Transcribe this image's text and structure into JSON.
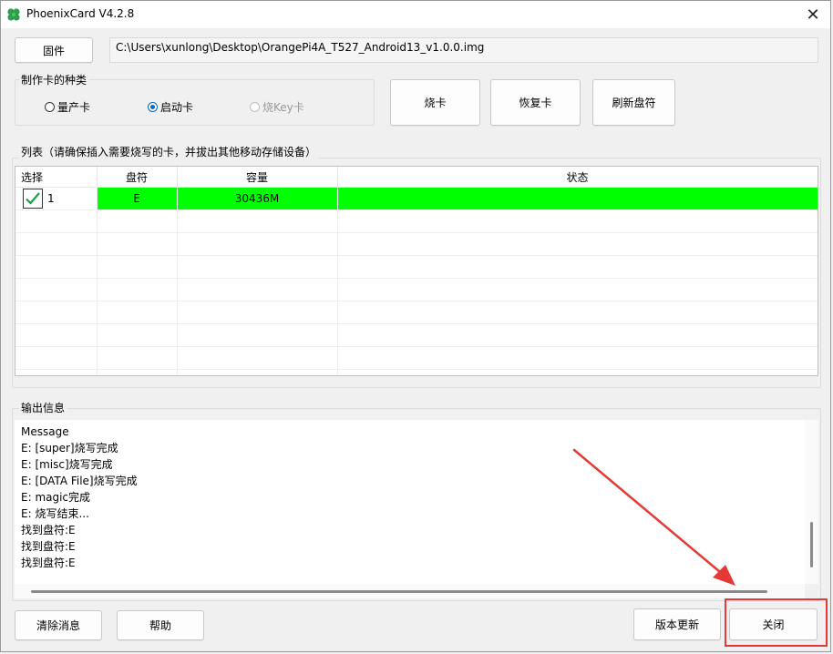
{
  "window": {
    "title": "PhoenixCard V4.2.8",
    "close_glyph": "✕"
  },
  "firmware": {
    "button_label": "固件",
    "path": "C:\\Users\\xunlong\\Desktop\\OrangePi4A_T527_Android13_v1.0.0.img"
  },
  "card_type": {
    "group_label": "制作卡的种类",
    "options": [
      {
        "label": "量产卡",
        "checked": false,
        "disabled": false
      },
      {
        "label": "启动卡",
        "checked": true,
        "disabled": false
      },
      {
        "label": "烧Key卡",
        "checked": false,
        "disabled": true
      }
    ]
  },
  "actions": {
    "burn_label": "烧卡",
    "restore_label": "恢复卡",
    "refresh_label": "刷新盘符"
  },
  "list": {
    "group_label": "列表（请确保插入需要烧写的卡，并拔出其他移动存储设备）",
    "columns": [
      "选择",
      "盘符",
      "容量",
      "状态"
    ],
    "rows": [
      {
        "index": "1",
        "drive": "E",
        "capacity": "30436M",
        "status": "",
        "checked": true
      }
    ]
  },
  "output": {
    "group_label": "输出信息",
    "lines": [
      "Message",
      "E: [super]烧写完成",
      "E: [misc]烧写完成",
      "E: [DATA File]烧写完成",
      "E: magic完成",
      "E: 烧写结束...",
      "找到盘符:E",
      "找到盘符:E",
      "找到盘符:E"
    ]
  },
  "footer": {
    "clear_label": "清除消息",
    "help_label": "帮助",
    "update_label": "版本更新",
    "close_label": "关闭"
  },
  "colors": {
    "active_row": "#00ff00",
    "annotation": "#e53935",
    "radio_checked": "#0067c0"
  },
  "icons": {
    "app": "clover-icon",
    "check": "checkmark-icon",
    "close": "close-icon"
  }
}
